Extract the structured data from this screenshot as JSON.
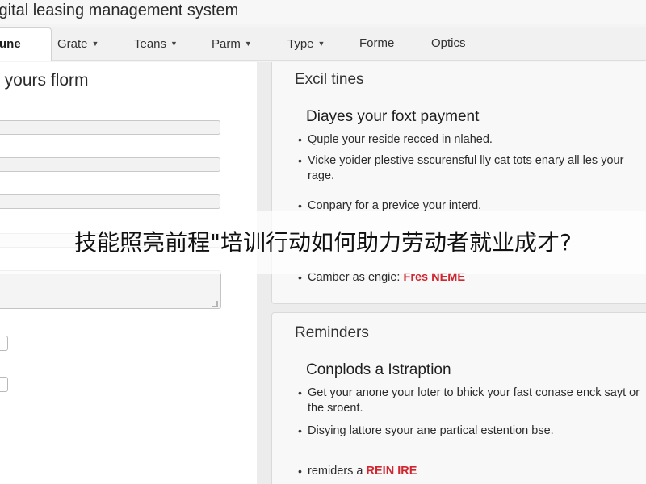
{
  "window": {
    "title": "igital leasing management system"
  },
  "nav": {
    "tabs": [
      {
        "label": "une",
        "caret": ""
      },
      {
        "label": "Grate",
        "caret": "▼"
      },
      {
        "label": "Teans",
        "caret": "▼"
      },
      {
        "label": "Parm",
        "caret": "▼"
      },
      {
        "label": "Type",
        "caret": "▼"
      },
      {
        "label": "Forme",
        "caret": ""
      },
      {
        "label": "Optics",
        "caret": ""
      }
    ],
    "active_index": 0
  },
  "form": {
    "title": "t yours florm",
    "fields": [
      {
        "value": "",
        "placeholder": ""
      },
      {
        "value": "",
        "placeholder": ""
      },
      {
        "value": "",
        "placeholder": ""
      },
      {
        "value": "",
        "placeholder": ""
      }
    ],
    "textarea": {
      "value": "",
      "placeholder": ""
    },
    "checkboxes": [
      {
        "checked": false
      },
      {
        "checked": false
      }
    ]
  },
  "cards": [
    {
      "heading": "Excil tines",
      "subheading": "Diayes your foxt payment",
      "bullets": [
        {
          "text": "Quple your reside recced in nlahed."
        },
        {
          "text": "Vicke yoider plestive sscurensful lly cat tots enary all les your rage."
        },
        {
          "text": "Conpary for a previce your interd."
        },
        {
          "text": "Camber as engle: ",
          "tag": "Fres NEME"
        }
      ]
    },
    {
      "heading": "Reminders",
      "subheading": "Conplods a Istraption",
      "bullets": [
        {
          "text": "Get your anone your loter to bhick your fast conase enck sayt or the sroent."
        },
        {
          "text": "Disying lattore syour ane partical estention bse."
        },
        {
          "text": "remiders a ",
          "tag": "REIN IRE"
        }
      ]
    }
  ],
  "overlay": {
    "caption": "技能照亮前程\"培训行动如何助力劳动者就业成才?"
  },
  "colors": {
    "accent_red": "#d0262f",
    "page_bg": "#f4f4f4"
  }
}
